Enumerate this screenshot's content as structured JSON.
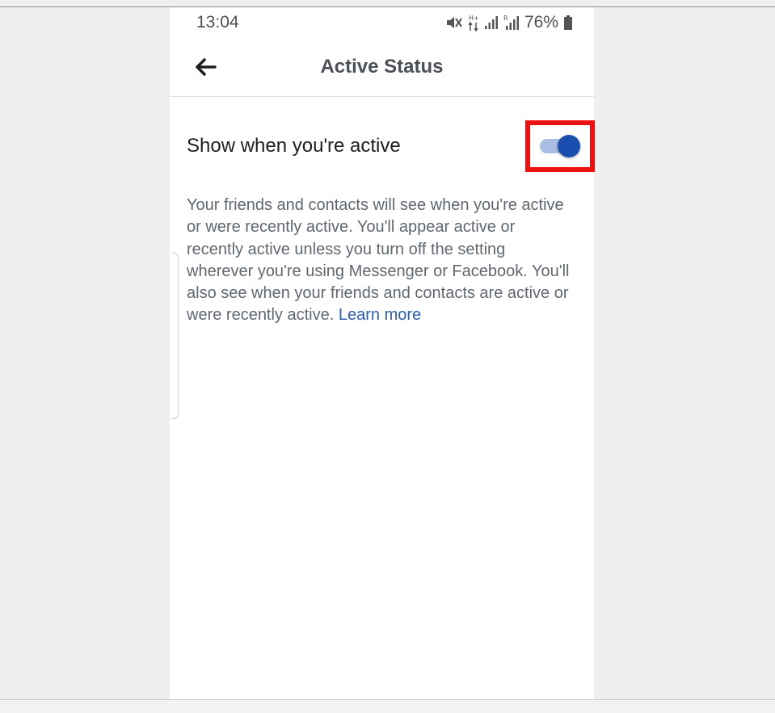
{
  "status_bar": {
    "time": "13:04",
    "battery_percent": "76%",
    "icons": [
      "mute-icon",
      "data-arrows-icon",
      "signal-icon",
      "signal-roaming-icon",
      "battery-icon"
    ]
  },
  "header": {
    "title": "Active Status",
    "back_icon": "arrow-left-icon"
  },
  "setting": {
    "label": "Show when you're active",
    "toggle_on": true,
    "highlight_color": "#ee1111"
  },
  "description": {
    "text": "Your friends and contacts will see when you're active or were recently active. You'll appear active or recently active unless you turn off the setting wherever you're using Messenger or Facebook. You'll also see when your friends and contacts are active or were recently active.",
    "link_text": "Learn more"
  },
  "colors": {
    "toggle_thumb": "#1a4fb0",
    "toggle_track": "#a9bde5",
    "link": "#2a5db0"
  }
}
